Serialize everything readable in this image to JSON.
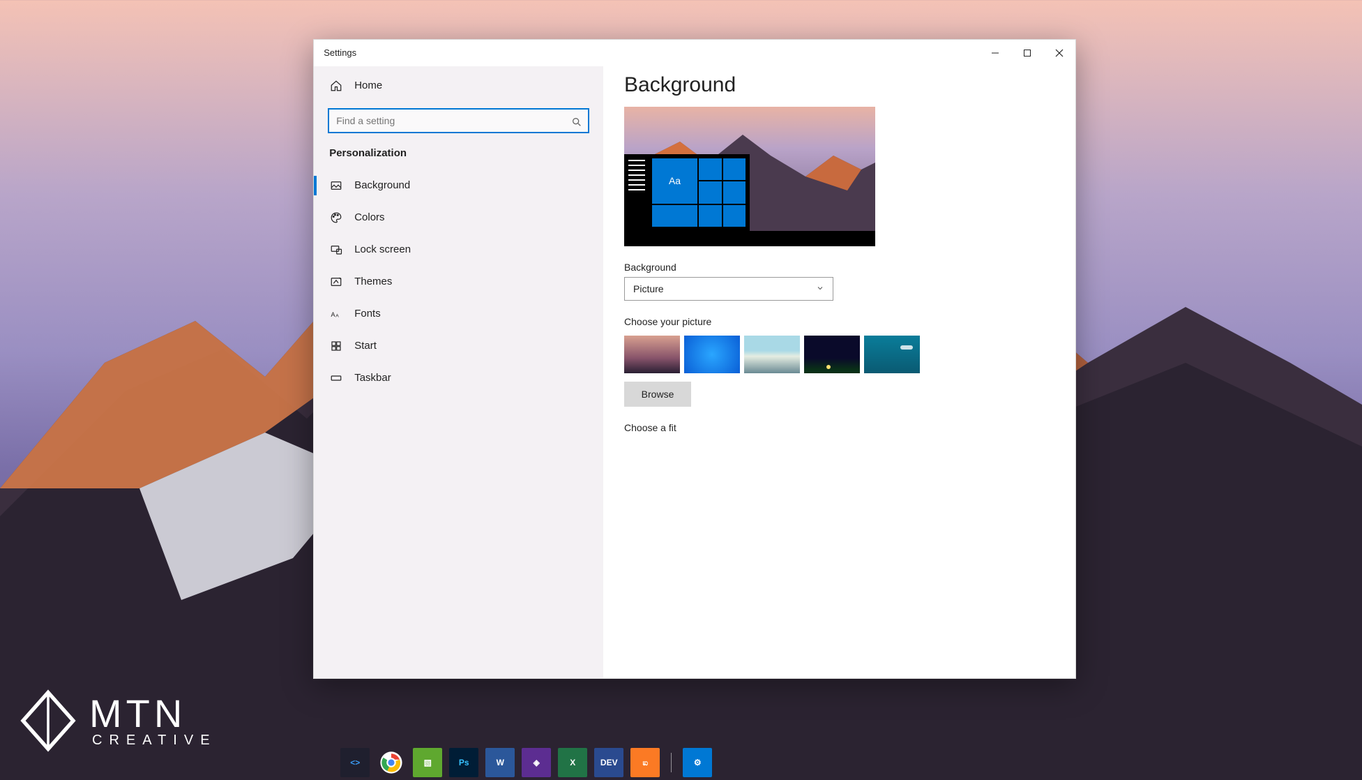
{
  "window": {
    "title": "Settings",
    "controls": {
      "minimize": "–",
      "maximize": "□",
      "close": "✕"
    }
  },
  "sidebar": {
    "home_label": "Home",
    "search_placeholder": "Find a setting",
    "section_label": "Personalization",
    "items": [
      {
        "label": "Background",
        "icon": "image-icon",
        "active": true
      },
      {
        "label": "Colors",
        "icon": "palette-icon",
        "active": false
      },
      {
        "label": "Lock screen",
        "icon": "lock-screen-icon",
        "active": false
      },
      {
        "label": "Themes",
        "icon": "themes-icon",
        "active": false
      },
      {
        "label": "Fonts",
        "icon": "fonts-icon",
        "active": false
      },
      {
        "label": "Start",
        "icon": "start-icon",
        "active": false
      },
      {
        "label": "Taskbar",
        "icon": "taskbar-icon",
        "active": false
      }
    ]
  },
  "content": {
    "heading": "Background",
    "preview_tile_text": "Aa",
    "background_label": "Background",
    "background_value": "Picture",
    "choose_picture_label": "Choose your picture",
    "browse_label": "Browse",
    "choose_fit_label": "Choose a fit"
  },
  "watermark": {
    "big": "MTN",
    "small": "CREATIVE"
  },
  "taskbar": {
    "apps": [
      {
        "name": "vscode-icon",
        "bg": "#1f1f2e",
        "initial": "<>",
        "color": "#3a9bf4"
      },
      {
        "name": "chrome-icon",
        "bg": "transparent",
        "initial": "",
        "color": "#fff"
      },
      {
        "name": "corel-icon",
        "bg": "#5fa82f",
        "initial": "▧",
        "color": "#fff"
      },
      {
        "name": "photoshop-icon",
        "bg": "#001d36",
        "initial": "Ps",
        "color": "#37c2ff"
      },
      {
        "name": "word-icon",
        "bg": "#2b579a",
        "initial": "W",
        "color": "#fff"
      },
      {
        "name": "visualstudio-icon",
        "bg": "#5c2d91",
        "initial": "◈",
        "color": "#fff"
      },
      {
        "name": "excel-icon",
        "bg": "#217346",
        "initial": "X",
        "color": "#fff"
      },
      {
        "name": "devcpp-icon",
        "bg": "#2a4a8f",
        "initial": "DEV",
        "color": "#fff"
      },
      {
        "name": "xampp-icon",
        "bg": "#fb7a24",
        "initial": "ಐ",
        "color": "#fff"
      }
    ],
    "tray": [
      {
        "name": "settings-gear-icon",
        "bg": "#0078d4",
        "initial": "⚙",
        "color": "#fff"
      }
    ]
  }
}
